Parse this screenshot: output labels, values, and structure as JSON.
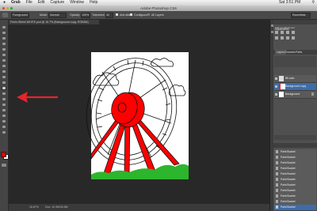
{
  "menubar": {
    "apple": "",
    "items": [
      "Grab",
      "File",
      "Edit",
      "Capture",
      "Window",
      "Help"
    ],
    "clock": "Sat 3:51 PM"
  },
  "window": {
    "title": "Adobe Photoshop CS6"
  },
  "options": {
    "fill_source": "Foreground",
    "mode_label": "Mode:",
    "mode_value": "Normal",
    "opacity_label": "Opacity:",
    "opacity_value": "100%",
    "tolerance_label": "Tolerance:",
    "tolerance_value": "32",
    "antialias_label": "Anti-alias",
    "contiguous_label": "Contiguous",
    "all_layers_label": "All Layers",
    "workspace": "Essentials"
  },
  "document": {
    "tab": "Ferris Wheel WHITE.psd @ 16.7% (Background copy, RGB/8#)",
    "zoom": "16.67%",
    "doc_size": "Doc: 10.3M/30.5M"
  },
  "panels": {
    "adjustments_title": "Adjustments",
    "add_adjustment": "Add an adjustment",
    "layers_tabs": [
      "Layers",
      "Channels",
      "Paths"
    ],
    "layers": [
      {
        "name": "fill color",
        "selected": false
      },
      {
        "name": "Background copy",
        "selected": true
      },
      {
        "name": "Background",
        "selected": false
      }
    ],
    "history_title": "History",
    "history": [
      "Paint Bucket",
      "Paint Bucket",
      "Paint Bucket",
      "Paint Bucket",
      "Paint Bucket",
      "Paint Bucket",
      "Paint Bucket",
      "Paint Bucket",
      "Paint Bucket",
      "Paint Bucket",
      "Paint Bucket",
      "Paint Bucket"
    ]
  },
  "colors": {
    "foreground": "#ff0000",
    "background": "#ffffff",
    "annotation_arrow": "#e4252b"
  }
}
